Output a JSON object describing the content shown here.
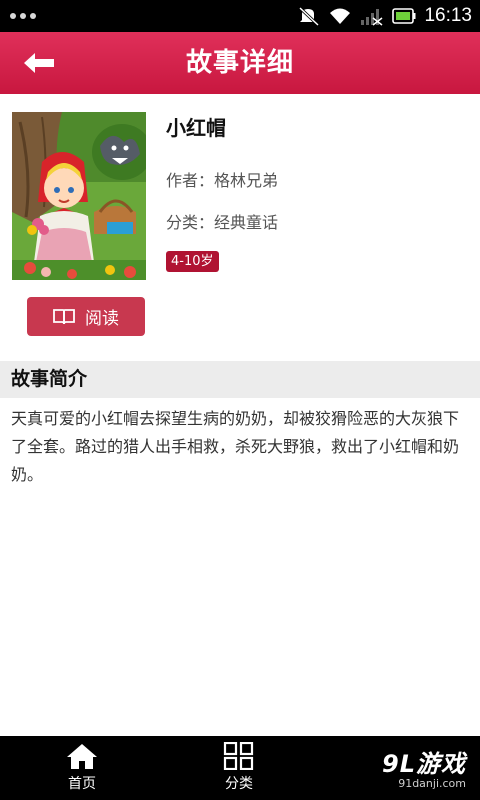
{
  "status_bar": {
    "time": "16:13"
  },
  "header": {
    "title": "故事详细"
  },
  "book": {
    "title": "小红帽",
    "author": "作者：格林兄弟",
    "category": "分类：经典童话",
    "age_range": "4-10岁",
    "read_label": "阅读"
  },
  "synopsis": {
    "heading": "故事简介",
    "text": "天真可爱的小红帽去探望生病的奶奶，却被狡猾险恶的大灰狼下了全套。路过的猎人出手相救，杀死大野狼，救出了小红帽和奶奶。"
  },
  "bottom_nav": {
    "items": [
      {
        "label": "首页",
        "icon": "home-icon"
      },
      {
        "label": "分类",
        "icon": "grid-icon"
      }
    ]
  },
  "watermark": {
    "logo": "9L游戏",
    "url": "91danji.com"
  },
  "colors": {
    "accent": "#c8173f",
    "button": "#c8384f",
    "badge": "#b01332"
  }
}
